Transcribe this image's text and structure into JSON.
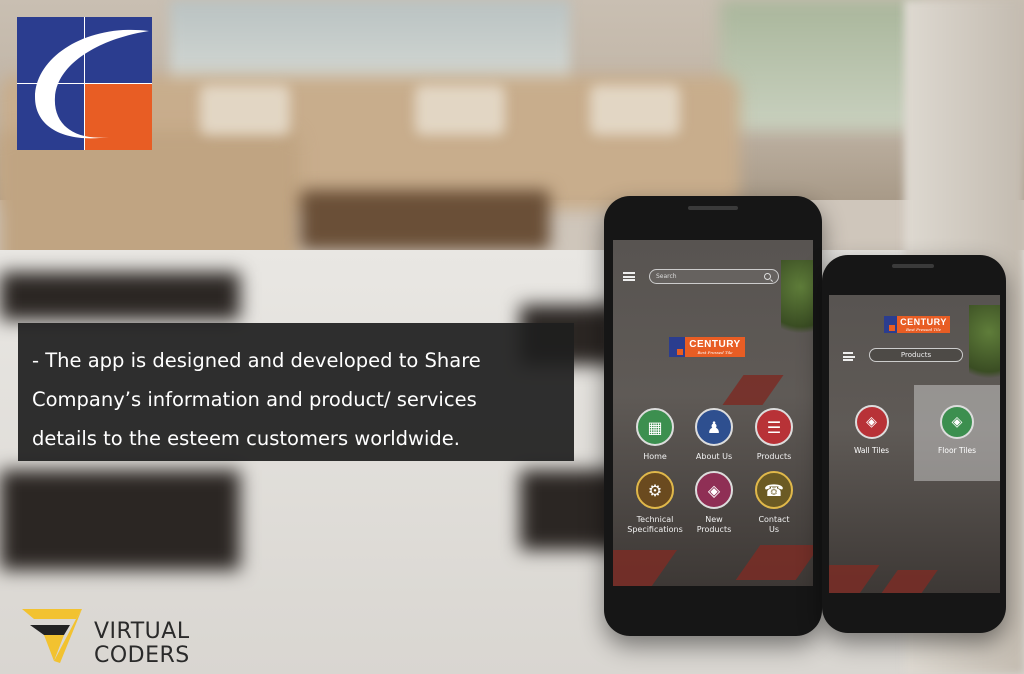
{
  "brand": {
    "logo_name": "century-logo",
    "colors": {
      "blue": "#2b3d8f",
      "orange": "#e85d24"
    }
  },
  "caption": {
    "lines": [
      "- The app is designed and developed to Share",
      " Company’s information and product/ services",
      "details to the esteem customers worldwide."
    ]
  },
  "developer": {
    "line1": "VIRTUAL",
    "line2": "CODERS",
    "accent": "#f2c230"
  },
  "phone_home": {
    "search_placeholder": "Search",
    "app_brand": "CENTURY",
    "app_tagline": "Best Pressed Tile",
    "menu": [
      {
        "label": "Home",
        "icon": "building-icon",
        "color": "#3c8f4f"
      },
      {
        "label": "About Us",
        "icon": "users-icon",
        "color": "#2e4f8f"
      },
      {
        "label": "Products",
        "icon": "layers-icon",
        "color": "#b83237"
      },
      {
        "label": "Technical\nSpecifications",
        "icon": "gear-icon",
        "color": "#6a4a1f"
      },
      {
        "label": "New\nProducts",
        "icon": "cube-icon",
        "color": "#8f2f55"
      },
      {
        "label": "Contact\nUs",
        "icon": "phone-icon",
        "color": "#6b5a24"
      }
    ]
  },
  "phone_products": {
    "app_brand": "CENTURY",
    "app_tagline": "Best Pressed Tile",
    "page_title": "Products",
    "categories": [
      {
        "label": "Wall Tiles",
        "icon": "tile-box-icon",
        "color": "#b83237"
      },
      {
        "label": "Floor Tiles",
        "icon": "tile-box-icon",
        "color": "#3c8f4f"
      }
    ]
  }
}
